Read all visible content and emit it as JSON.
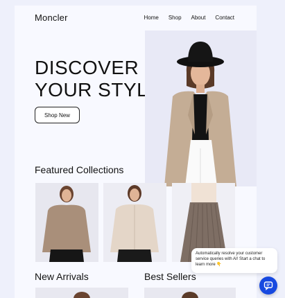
{
  "brand": "Moncler",
  "nav": {
    "home": "Home",
    "shop": "Shop",
    "about": "About",
    "contact": "Contact"
  },
  "hero": {
    "line1": "DISCOVER",
    "line2": "YOUR STYLE",
    "cta": "Shop New"
  },
  "sections": {
    "featured": "Featured Collections",
    "arrivals": "New Arrivals",
    "best": "Best Sellers"
  },
  "chat": {
    "message": "Automatically resolve your customer service queries with AI! Start a chat to learn more 👇"
  },
  "colors": {
    "accent": "#1749e0",
    "page_bg": "#f8f9ff",
    "outer_bg": "#eef0fb"
  },
  "icons": {
    "chat": "chat-bubble-icon"
  }
}
